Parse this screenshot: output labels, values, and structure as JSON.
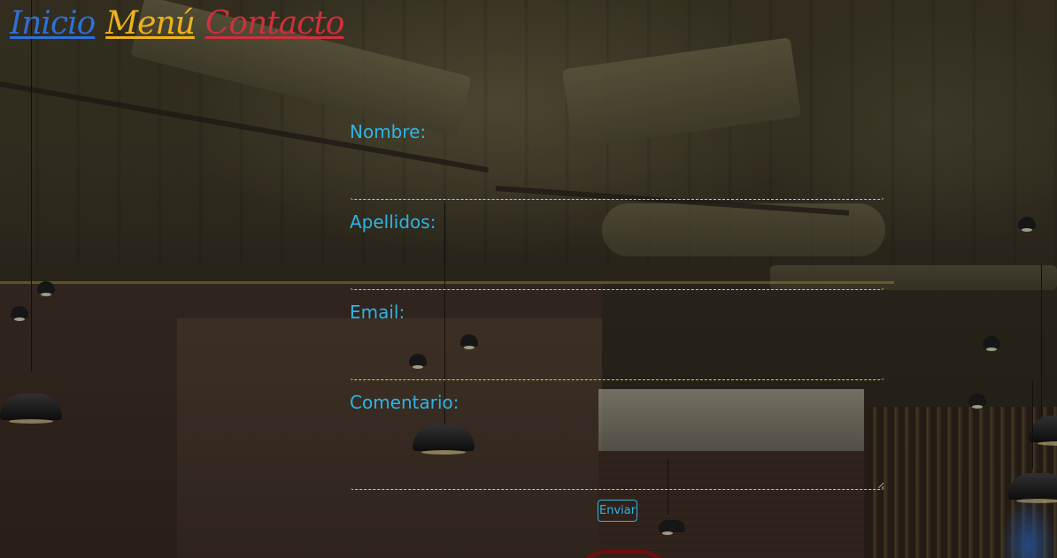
{
  "nav": {
    "items": [
      {
        "label": "Inicio",
        "color": "#2f6fd6"
      },
      {
        "label": "Menú",
        "color": "#f0b21a"
      },
      {
        "label": "Contacto",
        "color": "#d0303c"
      }
    ]
  },
  "form": {
    "nombre_label": "Nombre:",
    "nombre_value": "",
    "apellidos_label": "Apellidos:",
    "apellidos_value": "",
    "email_label": "Email:",
    "email_value": "",
    "comentario_label": "Comentario:",
    "comentario_value": "",
    "submit_label": "Enviar"
  },
  "colors": {
    "label": "#2fb4e4",
    "field_border": "#d8d82a"
  }
}
